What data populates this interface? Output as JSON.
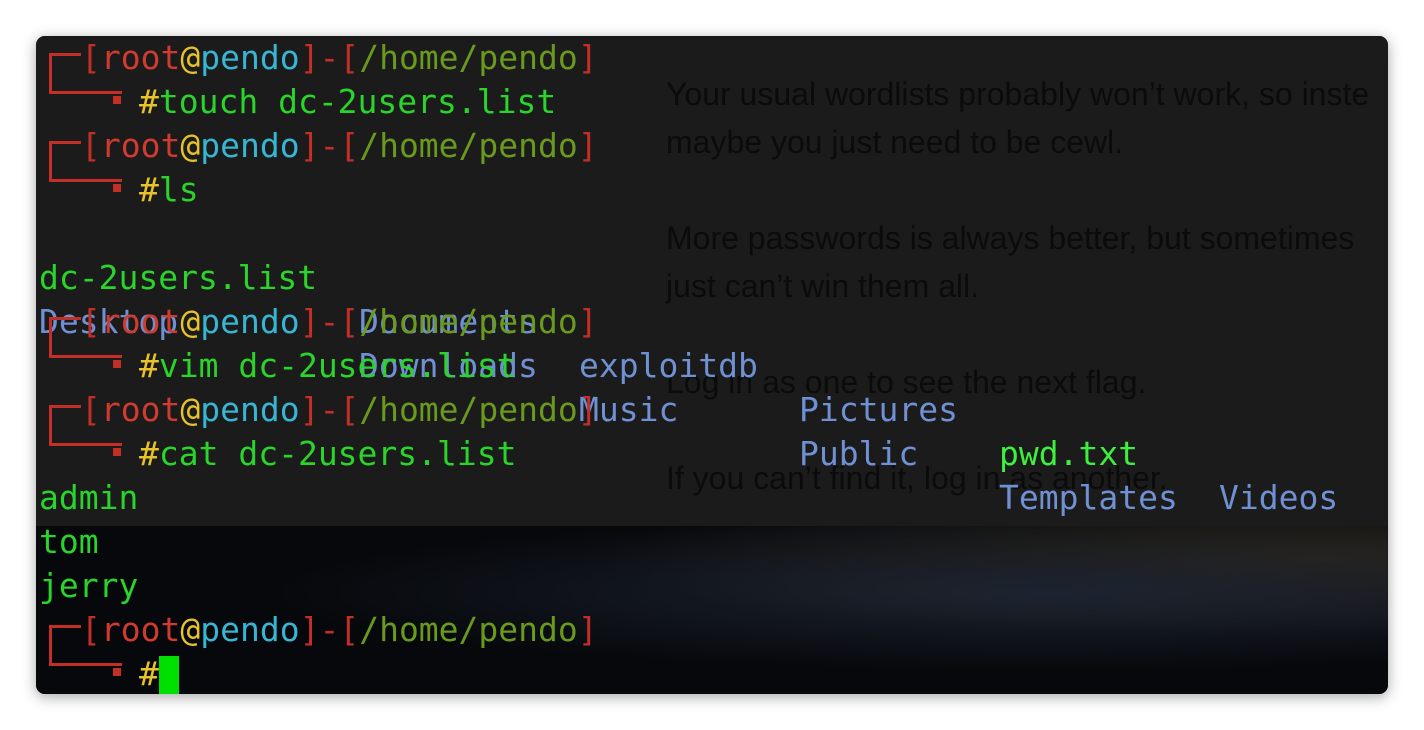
{
  "prompt": {
    "open_bracket": "[",
    "user": "root",
    "at": "@",
    "host": "pendo",
    "close_bracket": "]",
    "dash": "-",
    "path_bracket_open": "[",
    "path": "/home/pendo",
    "path_bracket_close": "]",
    "hash": "#"
  },
  "commands": [
    "touch dc-2users.list",
    "ls",
    "vim dc-2users.list",
    "cat dc-2users.list",
    ""
  ],
  "ls_output": {
    "row1": [
      "dc-2users.list",
      "Documents",
      "exploitdb",
      "Pictures",
      "pwd.txt",
      "Videos"
    ],
    "row2": [
      "Desktop",
      "Downloads",
      "Music",
      "Public",
      "Templates"
    ]
  },
  "cat_output": [
    "admin",
    "tom",
    "jerry"
  ],
  "background_page_lines": [
    "Your usual wordlists probably won’t work, so inste",
    "maybe you just need to be cewl.",
    "More passwords is always better, but sometimes",
    "just can’t win them all.",
    "Log in as one to see the next flag.",
    "If you can’t find it, log in as another."
  ],
  "colors": {
    "prompt_red": "#c32f27",
    "user_red": "#d13b2f",
    "at_yellow": "#e8c22a",
    "host_cyan": "#37b6d3",
    "path_green": "#6a9a1d",
    "command_green": "#2ad42a",
    "directory_blue": "#6f91d4",
    "cursor_green": "#00e000"
  }
}
